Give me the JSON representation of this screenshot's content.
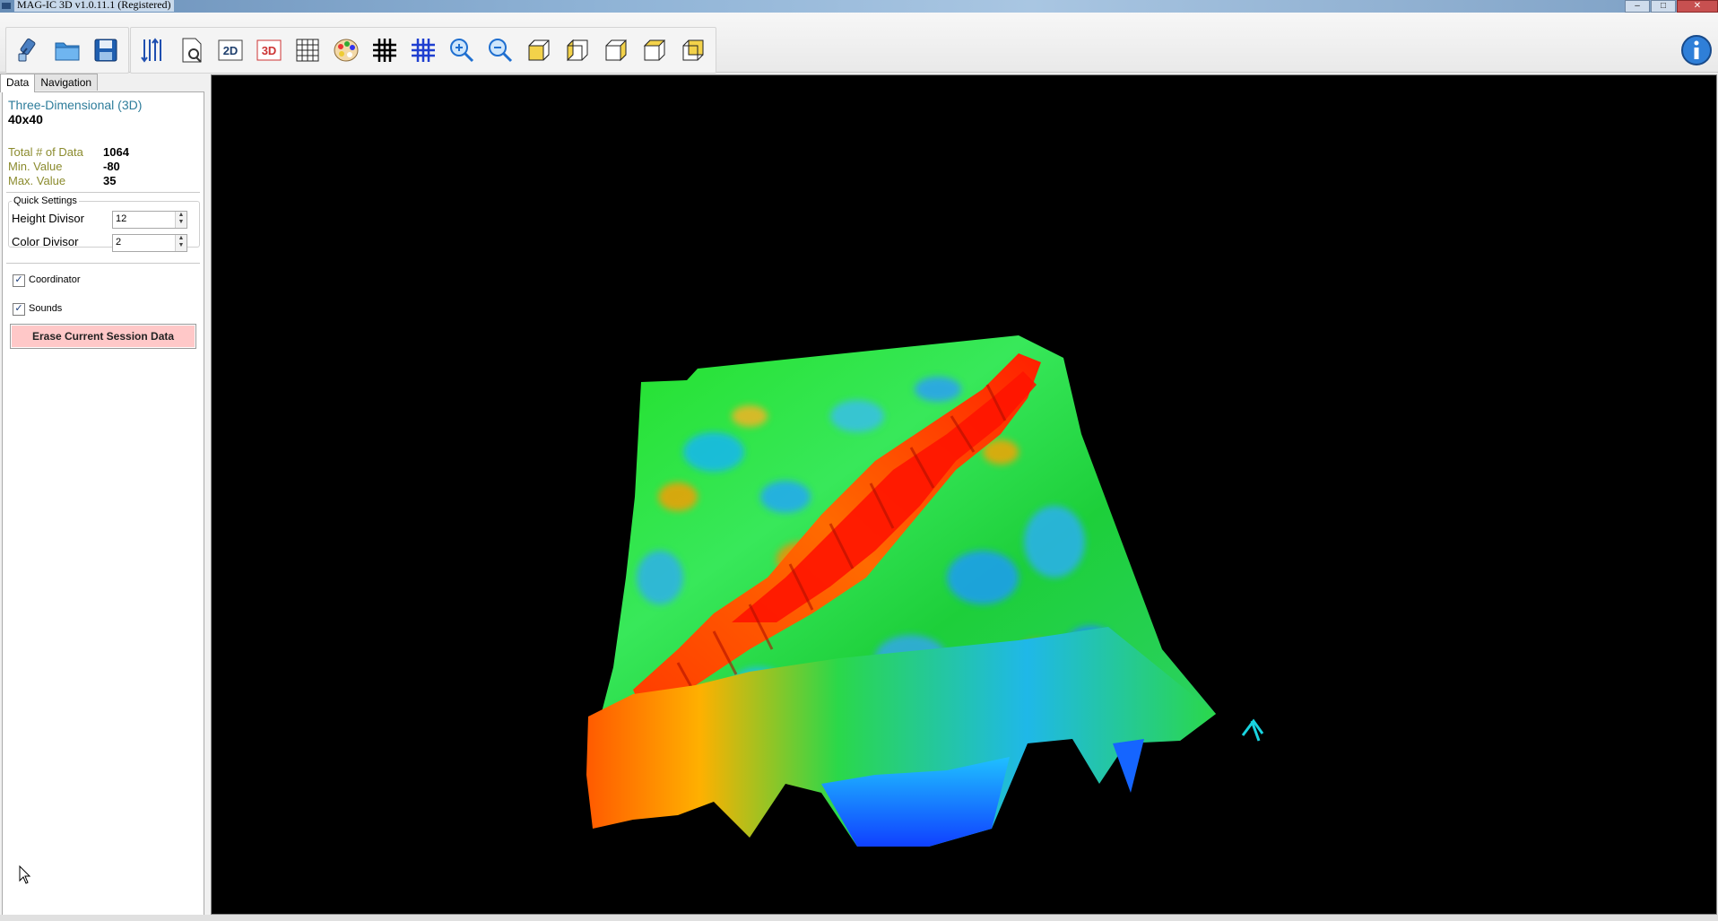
{
  "window": {
    "title": "MAG-IC 3D v1.0.11.1 (Registered)",
    "minimize": "–",
    "maximize": "□",
    "close": "✕"
  },
  "toolbar": {
    "buttons": [
      {
        "name": "connect-device-icon"
      },
      {
        "name": "open-folder-icon"
      },
      {
        "name": "save-disk-icon"
      },
      {
        "name": "data-columns-icon"
      },
      {
        "name": "preview-document-icon"
      },
      {
        "name": "view-2d-icon",
        "label": "2D"
      },
      {
        "name": "view-3d-icon",
        "label": "3D"
      },
      {
        "name": "grid-icon"
      },
      {
        "name": "color-palette-icon"
      },
      {
        "name": "grid-bold-icon"
      },
      {
        "name": "grid-blue-icon"
      },
      {
        "name": "zoom-in-icon"
      },
      {
        "name": "zoom-out-icon"
      },
      {
        "name": "cube-front-icon"
      },
      {
        "name": "cube-left-icon"
      },
      {
        "name": "cube-right-icon"
      },
      {
        "name": "cube-top-icon"
      },
      {
        "name": "cube-iso-icon"
      }
    ],
    "info_icon": "info-icon"
  },
  "panel": {
    "tabs": [
      "Data",
      "Navigation"
    ],
    "active_tab": "Data",
    "mode": "Three-Dimensional (3D)",
    "dimensions": "40x40",
    "stats": [
      {
        "label": "Total # of Data",
        "value": "1064"
      },
      {
        "label": "Min. Value",
        "value": "-80"
      },
      {
        "label": "Max. Value",
        "value": "35"
      }
    ],
    "quick_settings": {
      "title": "Quick Settings",
      "height_divisor_label": "Height Divisor",
      "height_divisor_value": "12",
      "color_divisor_label": "Color Divisor",
      "color_divisor_value": "2"
    },
    "coordinator_label": "Coordinator",
    "coordinator_checked": true,
    "sounds_label": "Sounds",
    "sounds_checked": true,
    "check_mark": "✓",
    "erase_button": "Erase Current Session Data"
  },
  "colors": {
    "viewport_bg": "#000000",
    "high": "#ff2a00",
    "mid": "#00e400",
    "low": "#0a7cff",
    "axis_marker": "#19d4e0"
  }
}
